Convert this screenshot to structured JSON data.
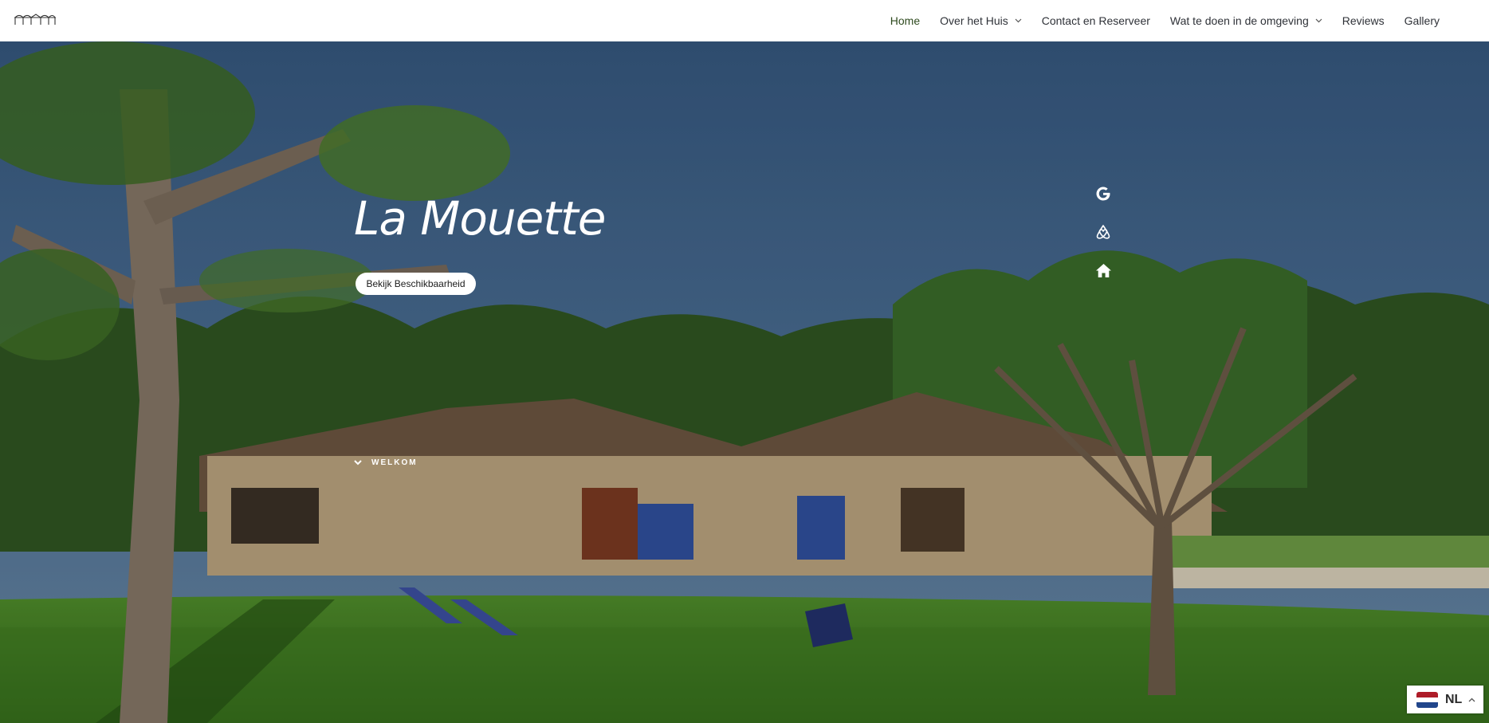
{
  "nav": {
    "items": [
      {
        "label": "Home",
        "active": true,
        "dropdown": false
      },
      {
        "label": "Over het Huis",
        "active": false,
        "dropdown": true
      },
      {
        "label": "Contact en Reserveer",
        "active": false,
        "dropdown": false
      },
      {
        "label": "Wat te doen in de omgeving",
        "active": false,
        "dropdown": true
      },
      {
        "label": "Reviews",
        "active": false,
        "dropdown": false
      },
      {
        "label": "Gallery",
        "active": false,
        "dropdown": false
      }
    ],
    "active_color": "#2e4a1e"
  },
  "hero": {
    "title": "La Mouette",
    "cta_label": "Bekijk Beschikbaarheid",
    "scroll_label": "WELKOM",
    "social_icons": [
      "google-icon",
      "airbnb-icon",
      "home-icon"
    ]
  },
  "language": {
    "code": "NL",
    "flag": "netherlands-flag-icon"
  }
}
